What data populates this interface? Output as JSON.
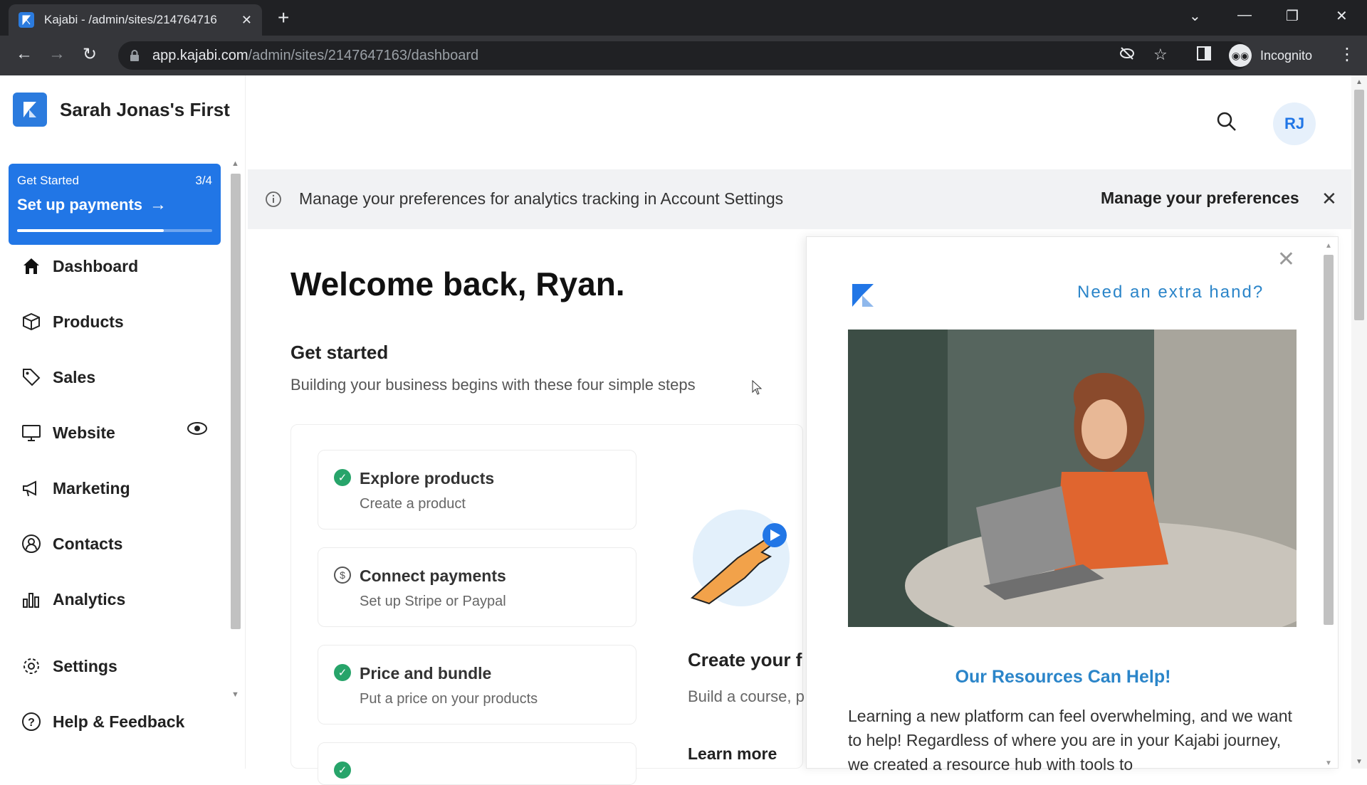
{
  "browser": {
    "tab_title": "Kajabi - /admin/sites/214764716",
    "url_host": "app.kajabi.com",
    "url_path": "/admin/sites/2147647163/dashboard",
    "profile_label": "Incognito"
  },
  "sidebar": {
    "site_name": "Sarah Jonas's First",
    "get_started": {
      "label": "Get Started",
      "count": "3/4",
      "title": "Set up payments",
      "progress": 0.75
    },
    "items": [
      {
        "label": "Dashboard",
        "icon": "home-icon"
      },
      {
        "label": "Products",
        "icon": "box-icon"
      },
      {
        "label": "Sales",
        "icon": "tag-icon"
      },
      {
        "label": "Website",
        "icon": "monitor-icon"
      },
      {
        "label": "Marketing",
        "icon": "megaphone-icon"
      },
      {
        "label": "Contacts",
        "icon": "user-circle-icon"
      },
      {
        "label": "Analytics",
        "icon": "bar-chart-icon"
      },
      {
        "label": "Settings",
        "icon": "gear-icon"
      },
      {
        "label": "Help & Feedback",
        "icon": "help-icon"
      }
    ]
  },
  "header": {
    "avatar_initials": "RJ"
  },
  "notice": {
    "message": "Manage your preferences for analytics tracking in Account Settings",
    "action": "Manage your preferences"
  },
  "main": {
    "welcome": "Welcome back, Ryan.",
    "get_started_title": "Get started",
    "get_started_sub": "Building your business begins with these four simple steps",
    "steps": [
      {
        "title": "Explore products",
        "subtitle": "Create a product",
        "done": true
      },
      {
        "title": "Connect payments",
        "subtitle": "Set up Stripe or Paypal",
        "done": false
      },
      {
        "title": "Price and bundle",
        "subtitle": "Put a price on your products",
        "done": true
      }
    ],
    "create_title": "Create your f",
    "create_sub": "Build a course, p",
    "learn_more": "Learn more"
  },
  "popup": {
    "title": "Need an extra hand?",
    "resources_title": "Our Resources Can Help!",
    "body": "Learning a new platform can feel overwhelming, and we want to help! Regardless of where you are in your Kajabi journey, we created a resource hub with tools to"
  },
  "colors": {
    "accent": "#2176e6",
    "link": "#2b85c9",
    "success": "#27a46a"
  }
}
